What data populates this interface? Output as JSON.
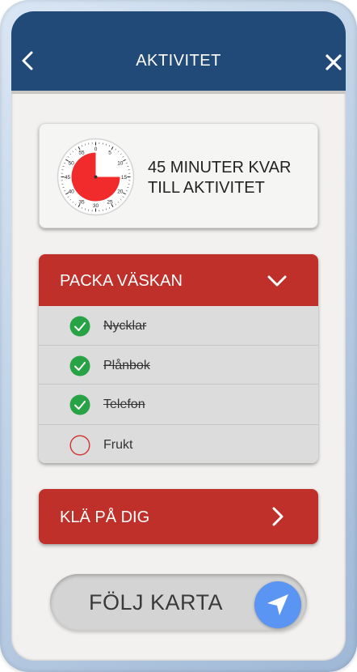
{
  "header": {
    "title": "AKTIVITET",
    "back_icon": "chevron-left-icon",
    "close_icon": "close-icon"
  },
  "timer": {
    "line1": "45 MINUTER KVAR",
    "line2": "TILL AKTIVITET",
    "remaining_minutes": 45,
    "dial_labels": [
      "0",
      "5",
      "10",
      "15",
      "20",
      "25",
      "30",
      "35",
      "40",
      "45",
      "50",
      "55"
    ]
  },
  "pack_section": {
    "title": "PACKA VÄSKAN",
    "expanded": true,
    "items": [
      {
        "label": "Nycklar",
        "done": true
      },
      {
        "label": "Plånbok",
        "done": true
      },
      {
        "label": "Telefon",
        "done": true
      },
      {
        "label": "Frukt",
        "done": false
      }
    ]
  },
  "dress_section": {
    "title": "KLÄ PÅ DIG",
    "expanded": false
  },
  "follow_map": {
    "label": "FÖLJ KARTA",
    "icon": "navigation-arrow-icon"
  },
  "colors": {
    "header": "#214a78",
    "section_red": "#c0302a",
    "timer_red": "#f12b2b",
    "check_green": "#27a244",
    "nav_blue": "#5b95f3"
  }
}
